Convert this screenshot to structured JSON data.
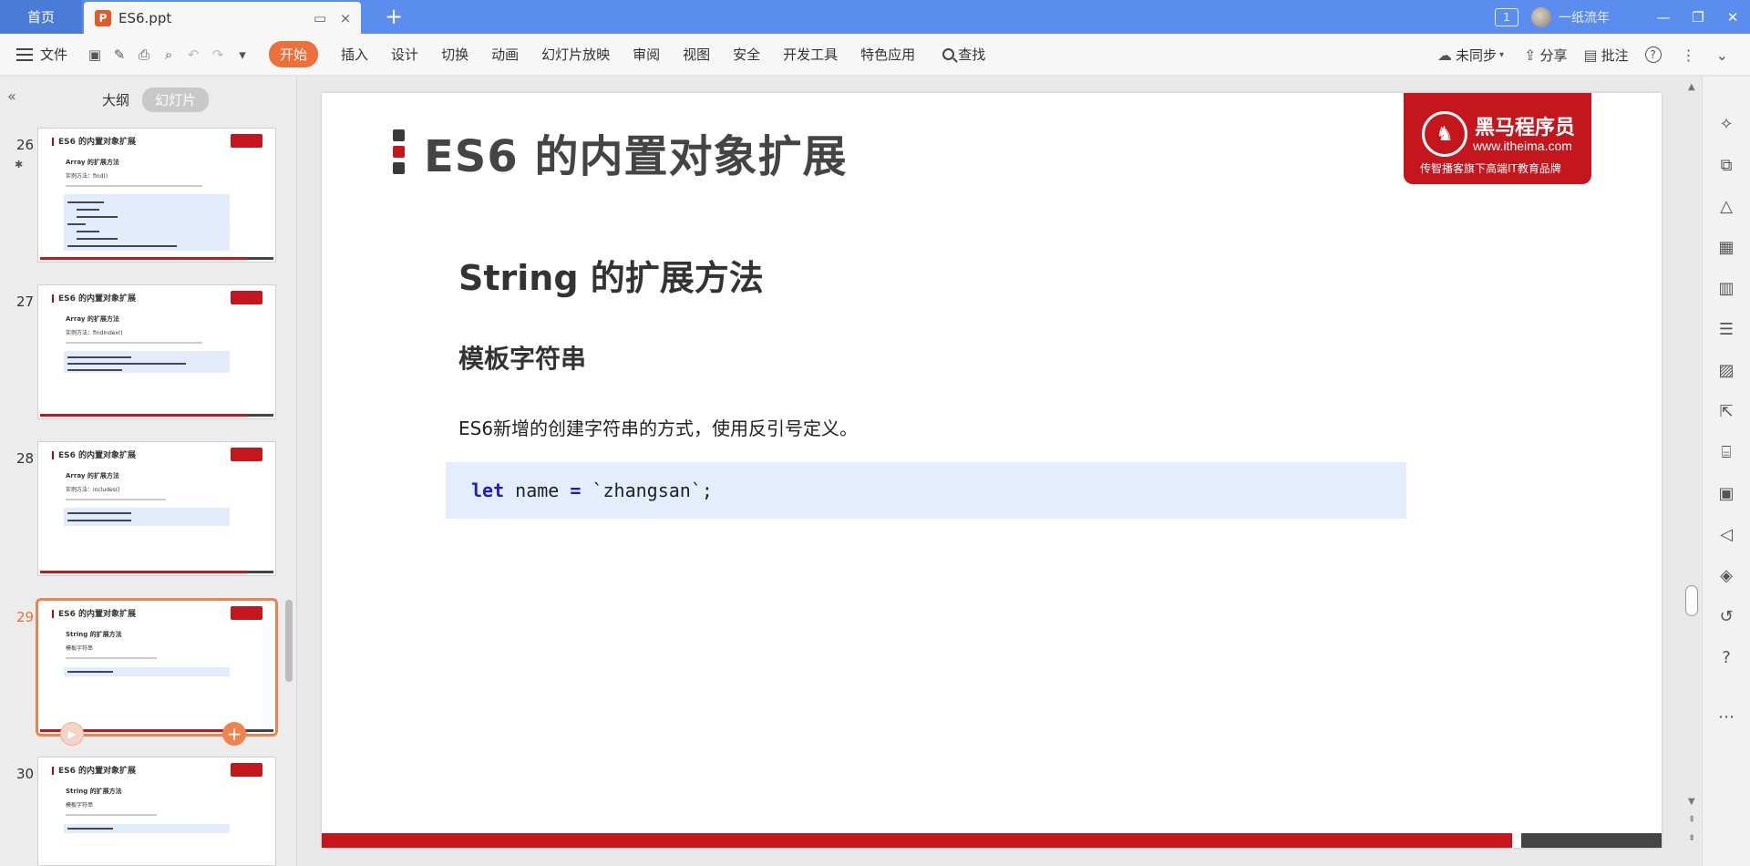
{
  "titlebar": {
    "home_tab": "首页",
    "doc_icon": "P",
    "doc_title": "ES6.ppt",
    "monitor_icon": "monitor-icon",
    "close_icon": "×",
    "add_tab": "+",
    "window_count": "1",
    "username": "一纸流年",
    "minimize": "—",
    "restore": "❐",
    "close": "✕"
  },
  "menu": {
    "file": "文件",
    "start": "开始",
    "items": [
      "插入",
      "设计",
      "切换",
      "动画",
      "幻灯片放映",
      "审阅",
      "视图",
      "安全",
      "开发工具",
      "特色应用"
    ],
    "search": "查找",
    "sync": "未同步",
    "share": "分享",
    "comment": "批注",
    "help": "?",
    "more": "⋮",
    "expand": "⌄"
  },
  "left_panel": {
    "collapse": "«",
    "tab_outline": "大纲",
    "tab_slides": "幻灯片",
    "slides": [
      {
        "num": "26",
        "title": "ES6 的内置对象扩展",
        "sub": "Array 的扩展方法",
        "sub2": "实例方法：find()"
      },
      {
        "num": "27",
        "title": "ES6 的内置对象扩展",
        "sub": "Array 的扩展方法",
        "sub2": "实例方法：findIndex()"
      },
      {
        "num": "28",
        "title": "ES6 的内置对象扩展",
        "sub": "Array 的扩展方法",
        "sub2": "实例方法：includes()"
      },
      {
        "num": "29",
        "title": "ES6 的内置对象扩展",
        "sub": "String 的扩展方法",
        "sub2": "模板字符串"
      },
      {
        "num": "30",
        "title": "ES6 的内置对象扩展",
        "sub": "String 的扩展方法",
        "sub2": "模板字符串"
      }
    ]
  },
  "slide": {
    "title": "ES6 的内置对象扩展",
    "heading": "String 的扩展方法",
    "subheading": "模板字符串",
    "paragraph": "ES6新增的创建字符串的方式，使用反引号定义。",
    "code_kw": "let",
    "code_var": " name ",
    "code_eq": "=",
    "code_rest": " `zhangsan`;",
    "logo_name": "黑马程序员",
    "logo_url": "www.itheima.com",
    "logo_slogan": "传智播客旗下高端IT教育品牌"
  },
  "colors": {
    "accent": "#ec6f3c",
    "titlebar": "#5b8def",
    "brand_red": "#c4161c"
  }
}
